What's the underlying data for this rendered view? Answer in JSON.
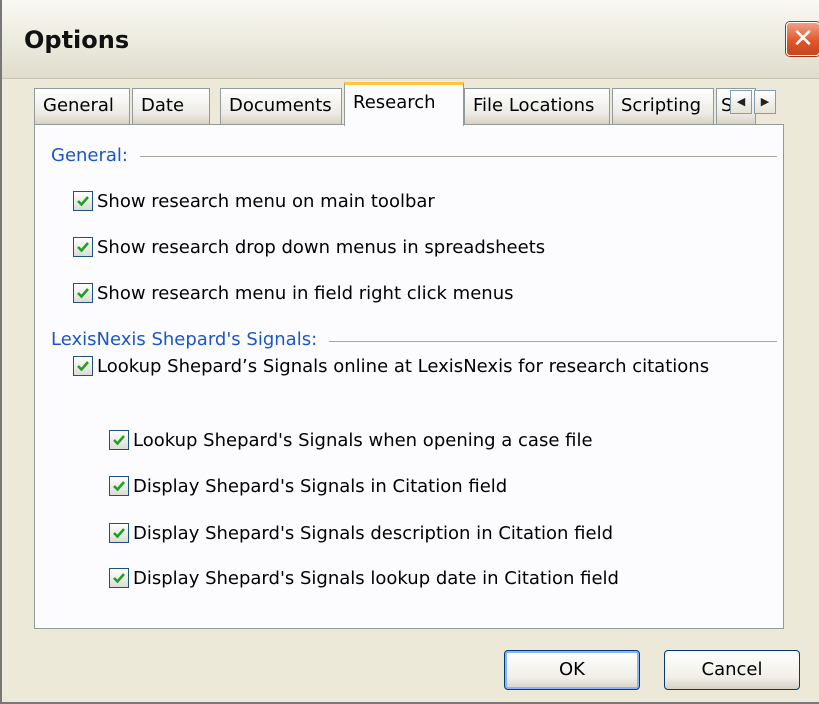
{
  "window": {
    "title": "Options",
    "close_glyph": "✕"
  },
  "tabs": [
    {
      "label": "General"
    },
    {
      "label": "Date"
    },
    {
      "label": "Documents"
    },
    {
      "label": "Research",
      "active": true
    },
    {
      "label": "File Locations"
    },
    {
      "label": "Scripting"
    },
    {
      "label": "Se"
    }
  ],
  "tab_scroll": {
    "left_glyph": "◀",
    "right_glyph": "▶"
  },
  "sections": {
    "general": {
      "label": "General:",
      "options": [
        {
          "label": "Show research menu on main toolbar",
          "checked": true
        },
        {
          "label": "Show research drop down menus in spreadsheets",
          "checked": true
        },
        {
          "label": "Show research menu in field right click menus",
          "checked": true
        }
      ]
    },
    "shepards": {
      "label": "LexisNexis Shepard's Signals:",
      "lookup_option": {
        "label": "Lookup Shepard’s Signals online at LexisNexis for research citations",
        "checked": true
      },
      "sub_options": [
        {
          "label": "Lookup Shepard's Signals when opening a case file",
          "checked": true
        },
        {
          "label": "Display Shepard's Signals in Citation field",
          "checked": true
        },
        {
          "label": "Display Shepard's Signals description in Citation field",
          "checked": true
        },
        {
          "label": "Display Shepard's Signals lookup date in Citation field",
          "checked": true
        }
      ]
    }
  },
  "buttons": {
    "ok": "OK",
    "cancel": "Cancel"
  },
  "colors": {
    "section_label": "#1c55c8",
    "checkmark": "#21a121",
    "active_tab_accent": "#ffc83c",
    "close_button": "#e2572c"
  }
}
